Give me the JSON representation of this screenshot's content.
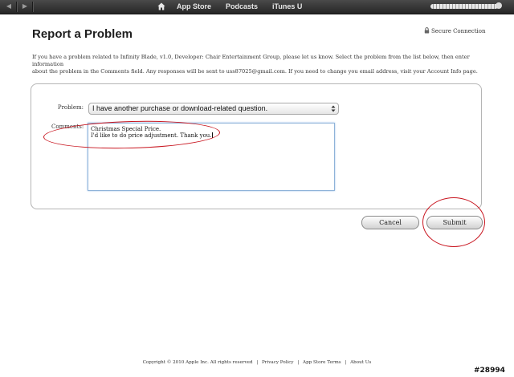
{
  "nav": {
    "back_glyph": "◀",
    "forward_glyph": "▶",
    "home_icon": "home-icon",
    "tabs": [
      {
        "label": "App Store"
      },
      {
        "label": "Podcasts"
      },
      {
        "label": "iTunes U"
      }
    ],
    "account_text_state": "redacted"
  },
  "header": {
    "title": "Report a Problem",
    "secure_label": "Secure Connection",
    "lock_icon": "lock-icon"
  },
  "intro": {
    "line1": "If you have a problem related to Infinity Blade, v1.0, Developer: Chair Entertainment Group, please let us know. Select the problem from the list below, then enter information",
    "line2": "about the problem in the Comments field. Any responses will be sent to uss87025@gmail.com. If you need to change you email address, visit your Account Info page."
  },
  "form": {
    "problem_label": "Problem:",
    "problem_value": "I have another purchase or download-related question.",
    "comments_label": "Comments:",
    "comments_line1": "Christmas Special Price.",
    "comments_line2": "I'd like to do price adjustment. Thank you."
  },
  "actions": {
    "cancel_label": "Cancel",
    "submit_label": "Submit"
  },
  "footer": {
    "copyright_prefix": "Copyright",
    "copyright_symbol": "©",
    "copyright_rest": "2010 Apple Inc.  All rights reserved",
    "privacy": "Privacy Policy",
    "terms": "App Store Terms",
    "about": "About Us",
    "separator": "|"
  },
  "watermark": "#28994",
  "colors": {
    "annotation_red": "#c8141e",
    "topbar": "#333333",
    "focus_border": "#8fb3d9"
  }
}
